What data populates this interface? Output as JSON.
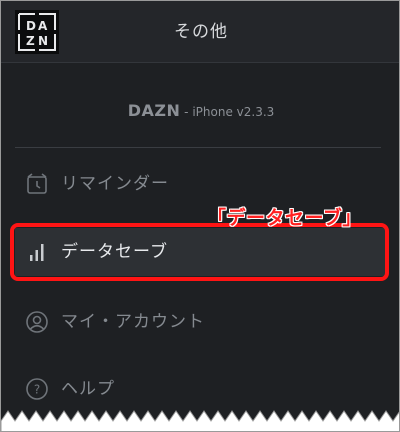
{
  "header": {
    "logo_icon": "dazn-logo-icon",
    "title": "その他"
  },
  "version": {
    "brand": "DAZN",
    "text": " - iPhone v2.3.3"
  },
  "menu": {
    "items": [
      {
        "id": "reminder",
        "label": "リマインダー",
        "icon": "alarm-clock-icon"
      },
      {
        "id": "data-save",
        "label": "データセーブ",
        "icon": "signal-bars-icon",
        "active": true
      },
      {
        "id": "my-account",
        "label": "マイ・アカウント",
        "icon": "user-circle-icon"
      },
      {
        "id": "help",
        "label": "ヘルプ",
        "icon": "question-circle-icon"
      }
    ]
  },
  "annotation": {
    "callout": "「データセーブ」",
    "highlight_color": "#ff1414"
  },
  "colors": {
    "background": "#1e2023",
    "header_background": "#24262a",
    "active_row": "#2d3034",
    "muted_text": "#858a90"
  }
}
